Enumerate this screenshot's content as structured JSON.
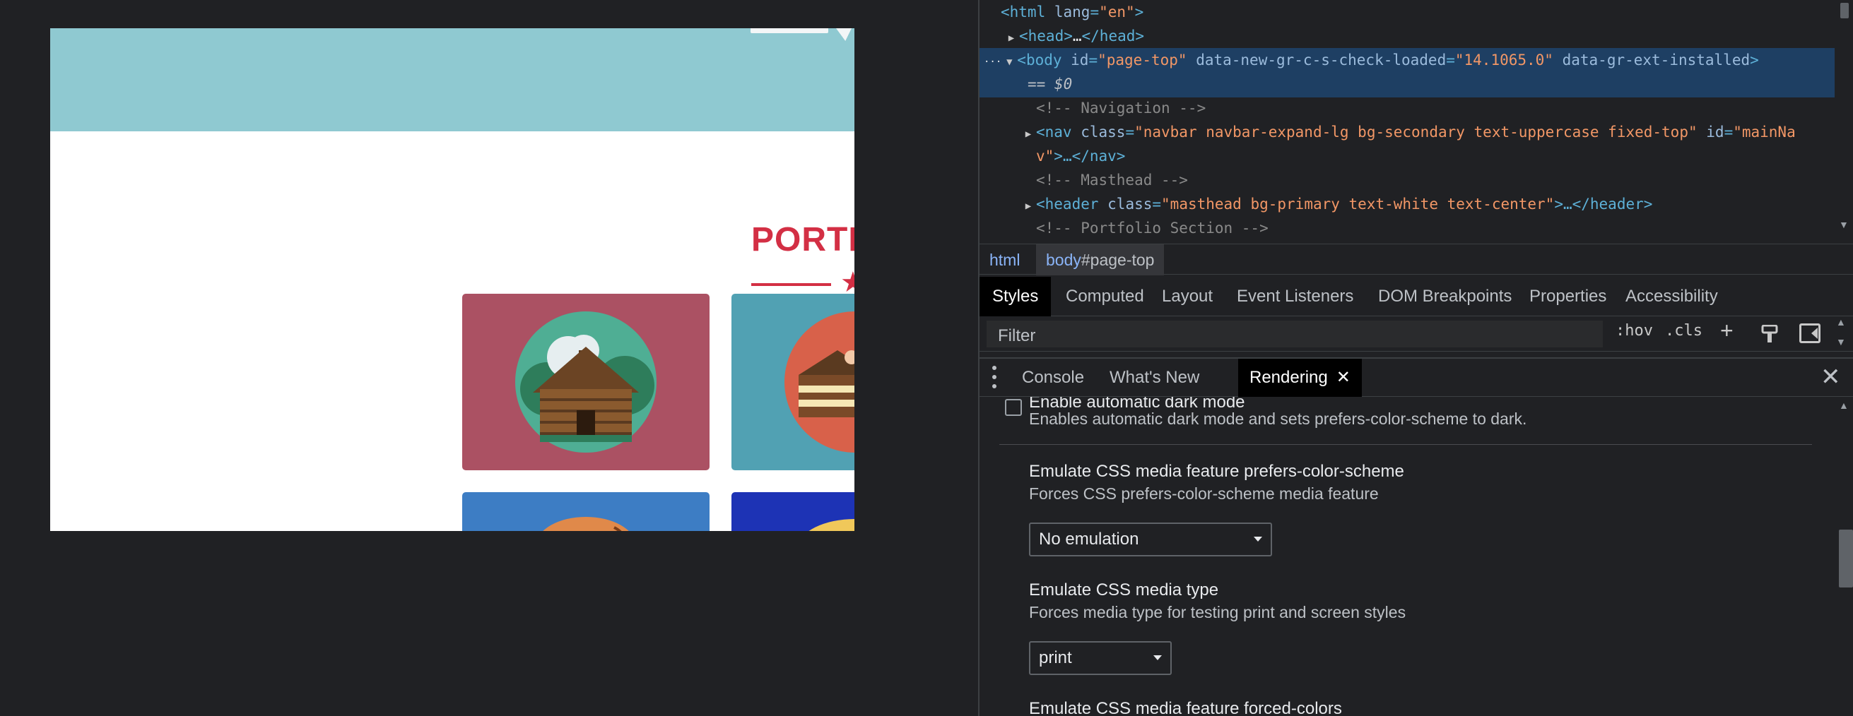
{
  "viewport": {
    "portfolio_title": "PORTF",
    "cards": [
      {
        "name": "log-cabin",
        "color": "#ab5163"
      },
      {
        "name": "cake",
        "color": "#51a1b3"
      },
      {
        "name": "circus-tent",
        "color": "#3d7dc4"
      },
      {
        "name": "game-controller",
        "color": "#1d33b5"
      }
    ],
    "masthead_color": "#8fc9d1",
    "accent_color": "#d32f44"
  },
  "elements": {
    "line1": {
      "open": "<html ",
      "attr": "lang",
      "eq": "=",
      "val": "\"en\"",
      "close": ">"
    },
    "line2": {
      "open": "<head>",
      "ell": "…",
      "close": "</head>"
    },
    "line3": {
      "prefix": "···",
      "open": "<body ",
      "a1": "id",
      "v1": "\"page-top\"",
      "a2": "data-new-gr-c-s-check-loaded",
      "v2": "\"14.1065.0\"",
      "a3": "data-gr-ext-installed",
      "close": ">"
    },
    "line4": "== $0",
    "line5": "<!-- Navigation -->",
    "line6": {
      "open": "<nav ",
      "a1": "class",
      "v1": "\"navbar navbar-expand-lg bg-secondary text-uppercase fixed-top\"",
      "a2": "id",
      "v2a": "\"mainNa",
      "v2b": "v\"",
      "ell": ">…</nav>"
    },
    "line7": "<!-- Masthead -->",
    "line8": {
      "open": "<header ",
      "a1": "class",
      "v1": "\"masthead bg-primary text-white text-center\"",
      "ell": ">…</header>"
    },
    "line9": "<!-- Portfolio Section -->"
  },
  "breadcrumbs": {
    "html": "html",
    "body_tag": "body",
    "body_id": "#page-top"
  },
  "styles_tabs": [
    "Styles",
    "Computed",
    "Layout",
    "Event Listeners",
    "DOM Breakpoints",
    "Properties",
    "Accessibility"
  ],
  "filter": {
    "placeholder": "Filter",
    "hov": ":hov",
    "cls": ".cls"
  },
  "drawer_tabs": [
    "Console",
    "What's New",
    "Rendering"
  ],
  "rendering": {
    "dark_mode_title": "Enable automatic dark mode",
    "dark_mode_desc": "Enables automatic dark mode and sets prefers-color-scheme to dark.",
    "color_scheme_title": "Emulate CSS media feature prefers-color-scheme",
    "color_scheme_desc": "Forces CSS prefers-color-scheme media feature",
    "color_scheme_value": "No emulation",
    "media_type_title": "Emulate CSS media type",
    "media_type_desc": "Forces media type for testing print and screen styles",
    "media_type_value": "print",
    "forced_colors_title": "Emulate CSS media feature forced-colors"
  }
}
